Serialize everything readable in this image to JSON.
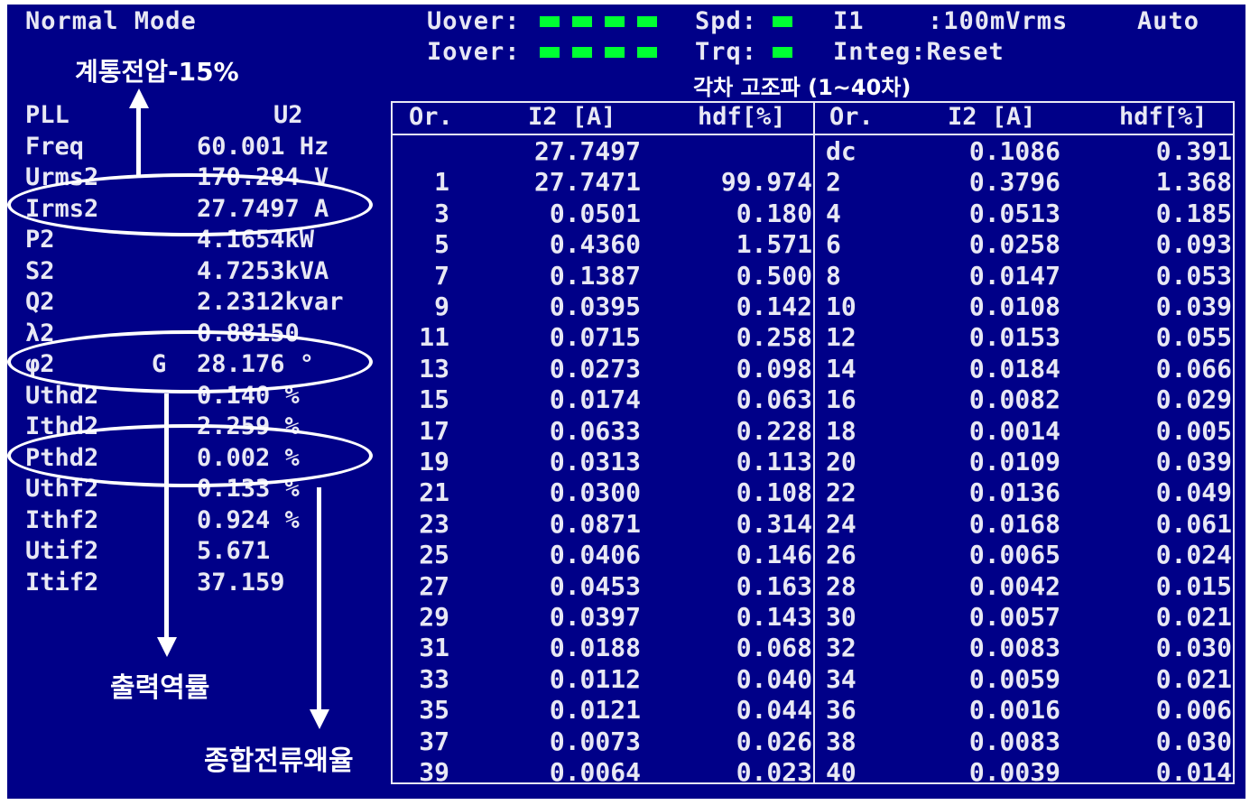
{
  "header": {
    "mode": "Normal Mode",
    "uover_label": "Uover:",
    "iover_label": "Iover:",
    "spd_label": "Spd:",
    "trq_label": "Trq:",
    "range_label": "I1",
    "range_value": ":100mVrms",
    "range_mode": "Auto",
    "integ": "Integ:Reset",
    "indicator_color": "#00ff33"
  },
  "annotations": {
    "grid_voltage": "계통전압-15%",
    "harmonics": "각차 고조파 (1~40차)",
    "output_pf": "출력역률",
    "total_thd": "종합전류왜율"
  },
  "params": [
    {
      "label": "PLL",
      "value": "U2"
    },
    {
      "label": "Freq",
      "value": "60.001 Hz"
    },
    {
      "label": "Urms2",
      "value": "170.284 V"
    },
    {
      "label": "Irms2",
      "value": "27.7497 A"
    },
    {
      "label": "P2",
      "value": "4.1654kW"
    },
    {
      "label": "S2",
      "value": "4.7253kVA"
    },
    {
      "label": "Q2",
      "value": "2.2312kvar"
    },
    {
      "label": "λ2",
      "value": "0.88150"
    },
    {
      "label": "φ2",
      "extra": "G",
      "value": "28.176 °"
    },
    {
      "label": "Uthd2",
      "value": "0.140 %"
    },
    {
      "label": "Ithd2",
      "value": "2.259 %"
    },
    {
      "label": "Pthd2",
      "value": "0.002 %"
    },
    {
      "label": "Uthf2",
      "value": "0.133 %"
    },
    {
      "label": "Ithf2",
      "value": "0.924 %"
    },
    {
      "label": "Utif2",
      "value": "5.671"
    },
    {
      "label": "Itif2",
      "value": "37.159"
    }
  ],
  "table": {
    "headers": [
      "Or.",
      "I2 [A]",
      "hdf[%]",
      "Or.",
      "I2 [A]",
      "hdf[%]"
    ],
    "rows": [
      [
        "",
        "27.7497",
        "",
        "dc",
        "0.1086",
        "0.391"
      ],
      [
        "1",
        "27.7471",
        "99.974",
        "2",
        "0.3796",
        "1.368"
      ],
      [
        "3",
        "0.0501",
        "0.180",
        "4",
        "0.0513",
        "0.185"
      ],
      [
        "5",
        "0.4360",
        "1.571",
        "6",
        "0.0258",
        "0.093"
      ],
      [
        "7",
        "0.1387",
        "0.500",
        "8",
        "0.0147",
        "0.053"
      ],
      [
        "9",
        "0.0395",
        "0.142",
        "10",
        "0.0108",
        "0.039"
      ],
      [
        "11",
        "0.0715",
        "0.258",
        "12",
        "0.0153",
        "0.055"
      ],
      [
        "13",
        "0.0273",
        "0.098",
        "14",
        "0.0184",
        "0.066"
      ],
      [
        "15",
        "0.0174",
        "0.063",
        "16",
        "0.0082",
        "0.029"
      ],
      [
        "17",
        "0.0633",
        "0.228",
        "18",
        "0.0014",
        "0.005"
      ],
      [
        "19",
        "0.0313",
        "0.113",
        "20",
        "0.0109",
        "0.039"
      ],
      [
        "21",
        "0.0300",
        "0.108",
        "22",
        "0.0136",
        "0.049"
      ],
      [
        "23",
        "0.0871",
        "0.314",
        "24",
        "0.0168",
        "0.061"
      ],
      [
        "25",
        "0.0406",
        "0.146",
        "26",
        "0.0065",
        "0.024"
      ],
      [
        "27",
        "0.0453",
        "0.163",
        "28",
        "0.0042",
        "0.015"
      ],
      [
        "29",
        "0.0397",
        "0.143",
        "30",
        "0.0057",
        "0.021"
      ],
      [
        "31",
        "0.0188",
        "0.068",
        "32",
        "0.0083",
        "0.030"
      ],
      [
        "33",
        "0.0112",
        "0.040",
        "34",
        "0.0059",
        "0.021"
      ],
      [
        "35",
        "0.0121",
        "0.044",
        "36",
        "0.0016",
        "0.006"
      ],
      [
        "37",
        "0.0073",
        "0.026",
        "38",
        "0.0083",
        "0.030"
      ],
      [
        "39",
        "0.0064",
        "0.023",
        "40",
        "0.0039",
        "0.014"
      ]
    ]
  }
}
